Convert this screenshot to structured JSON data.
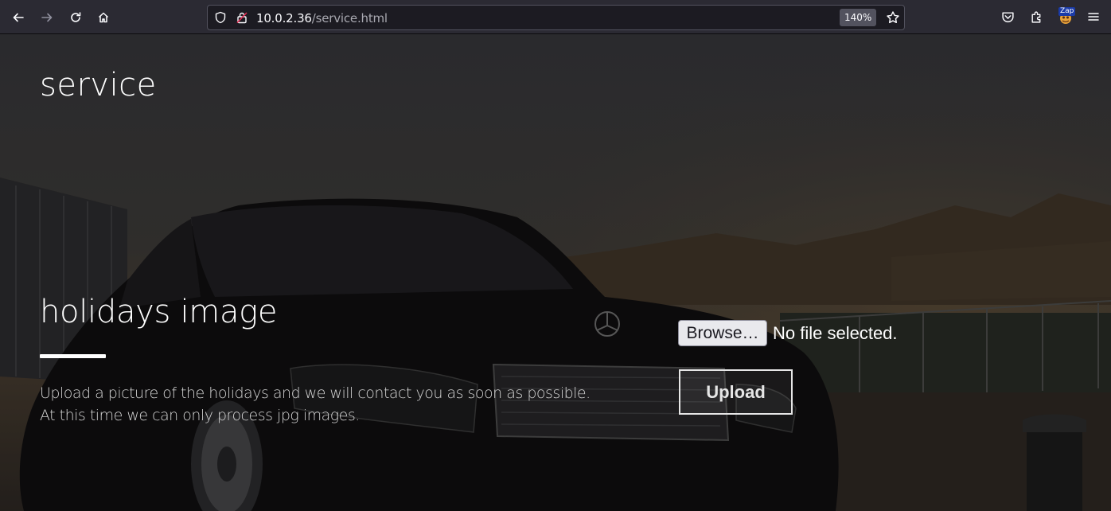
{
  "browser": {
    "url_host": "10.0.2.36",
    "url_path": "/service.html",
    "zoom": "140%",
    "zap_label": "Zap"
  },
  "page": {
    "title": "service",
    "section_heading": "holidays image",
    "description_line1": "Upload a picture of the holidays and we will contact you as soon as possible.",
    "description_line2": "At this time we can only process jpg images.",
    "browse_label": "Browse…",
    "file_status": "No file selected.",
    "upload_label": "Upload"
  },
  "icons": [
    "back-icon",
    "forward-icon",
    "reload-icon",
    "home-icon",
    "shield-icon",
    "insecure-lock-icon",
    "bookmark-star-icon",
    "pocket-icon",
    "extensions-icon",
    "zap-addon-icon",
    "menu-icon"
  ]
}
